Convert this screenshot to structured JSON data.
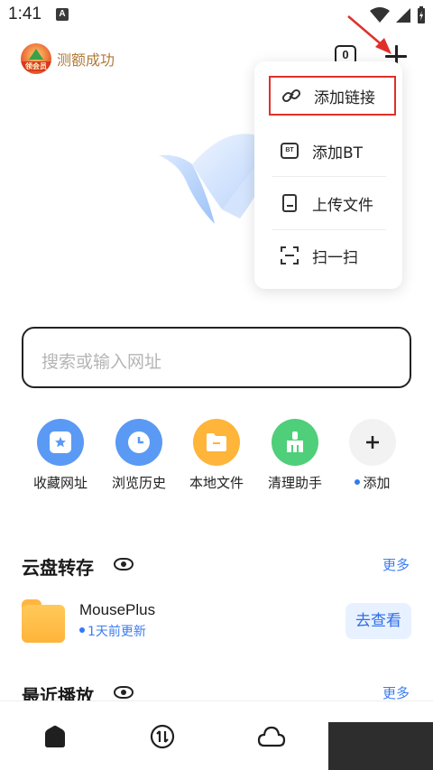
{
  "status_bar": {
    "time": "1:41",
    "notification_letter": "A"
  },
  "header": {
    "vip_badge_text": "领会员",
    "vip_text": "测额成功",
    "count_badge": "0"
  },
  "dropdown": {
    "items": [
      {
        "label": "添加链接",
        "icon": "link-icon"
      },
      {
        "label": "添加BT",
        "icon": "bt-icon"
      },
      {
        "label": "上传文件",
        "icon": "file-icon"
      },
      {
        "label": "扫一扫",
        "icon": "scan-icon"
      }
    ],
    "bt_icon_text": "BT",
    "highlight_color": "#e0302a"
  },
  "search": {
    "placeholder": "搜索或输入网址"
  },
  "shortcuts": [
    {
      "label": "收藏网址",
      "color": "#5a9af5",
      "icon": "bookmark-icon"
    },
    {
      "label": "浏览历史",
      "color": "#5a9af5",
      "icon": "clock-icon"
    },
    {
      "label": "本地文件",
      "color": "#ffb43a",
      "icon": "folder-icon"
    },
    {
      "label": "清理助手",
      "color": "#4fcf7a",
      "icon": "broom-icon"
    },
    {
      "label": "添加",
      "color": "#f2f2f2",
      "icon": "plus-icon"
    }
  ],
  "cloud_section": {
    "title": "云盘转存",
    "more": "更多"
  },
  "cloud_item": {
    "name": "MousePlus",
    "subtitle": "1天前更新",
    "action": "去查看"
  },
  "recent_section": {
    "title": "最近播放",
    "more": "更多"
  },
  "bottom_nav": [
    {
      "icon": "home-icon",
      "active": true
    },
    {
      "icon": "transfer-icon",
      "active": false
    },
    {
      "icon": "cloud-icon",
      "active": false
    }
  ],
  "accent_color": "#3d7cf0"
}
